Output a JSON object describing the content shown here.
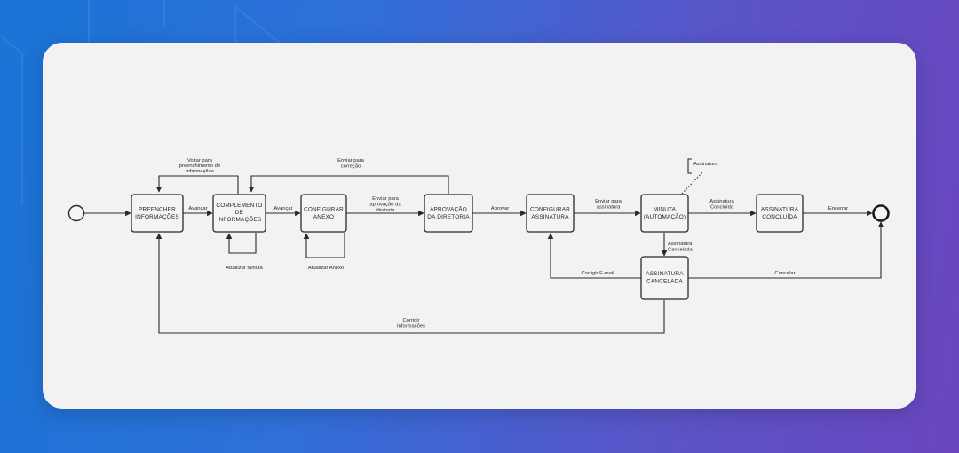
{
  "diagram": {
    "nodes": {
      "preencher": [
        "PREENCHER",
        "INFORMAÇÕES"
      ],
      "complemento": [
        "COMPLEMENTO",
        "DE",
        "INFORMAÇÕES"
      ],
      "configurar_anexo": [
        "CONFIGURAR",
        "ANEXO"
      ],
      "aprovacao": [
        "APROVAÇÃO",
        "DA DIRETORIA"
      ],
      "configurar_assinatura": [
        "CONFIGURAR",
        "ASSINATURA"
      ],
      "minuta": [
        "MINUTA",
        "(AUTOMAÇÃO)"
      ],
      "assinatura_concluida": [
        "ASSINATURA",
        "CONCLUÍDA"
      ],
      "assinatura_cancelada": [
        "ASSINATURA",
        "CANCELADA"
      ]
    },
    "annotation": "Assinatura",
    "edges": {
      "avancar_1": "Avançar",
      "avancar_2": "Avançar",
      "enviar_aprovacao": [
        "Enviar para",
        "aprovação da",
        "diretoria"
      ],
      "aprovar": "Aprovar",
      "enviar_assinatura": [
        "Enviar para",
        "assinatura"
      ],
      "assinatura_concluida": [
        "Assinatura",
        "Concluída"
      ],
      "encerrar": "Encerrar",
      "assinatura_cancelada": [
        "Assinatura",
        "Cancelada"
      ],
      "corrigir_email": "Corrigir E-mail",
      "cancelar": "Cancelar",
      "corrigir_informacoes": [
        "Corrigir",
        "Informações"
      ],
      "voltar_preenchimento": [
        "Voltar para",
        "preenchimento de",
        "informações"
      ],
      "enviar_correcao": [
        "Enviar para",
        "correção"
      ],
      "atualizar_minuta": "Atualizar Minuta",
      "atualizar_anexo": "Atualizar Anexo"
    }
  }
}
